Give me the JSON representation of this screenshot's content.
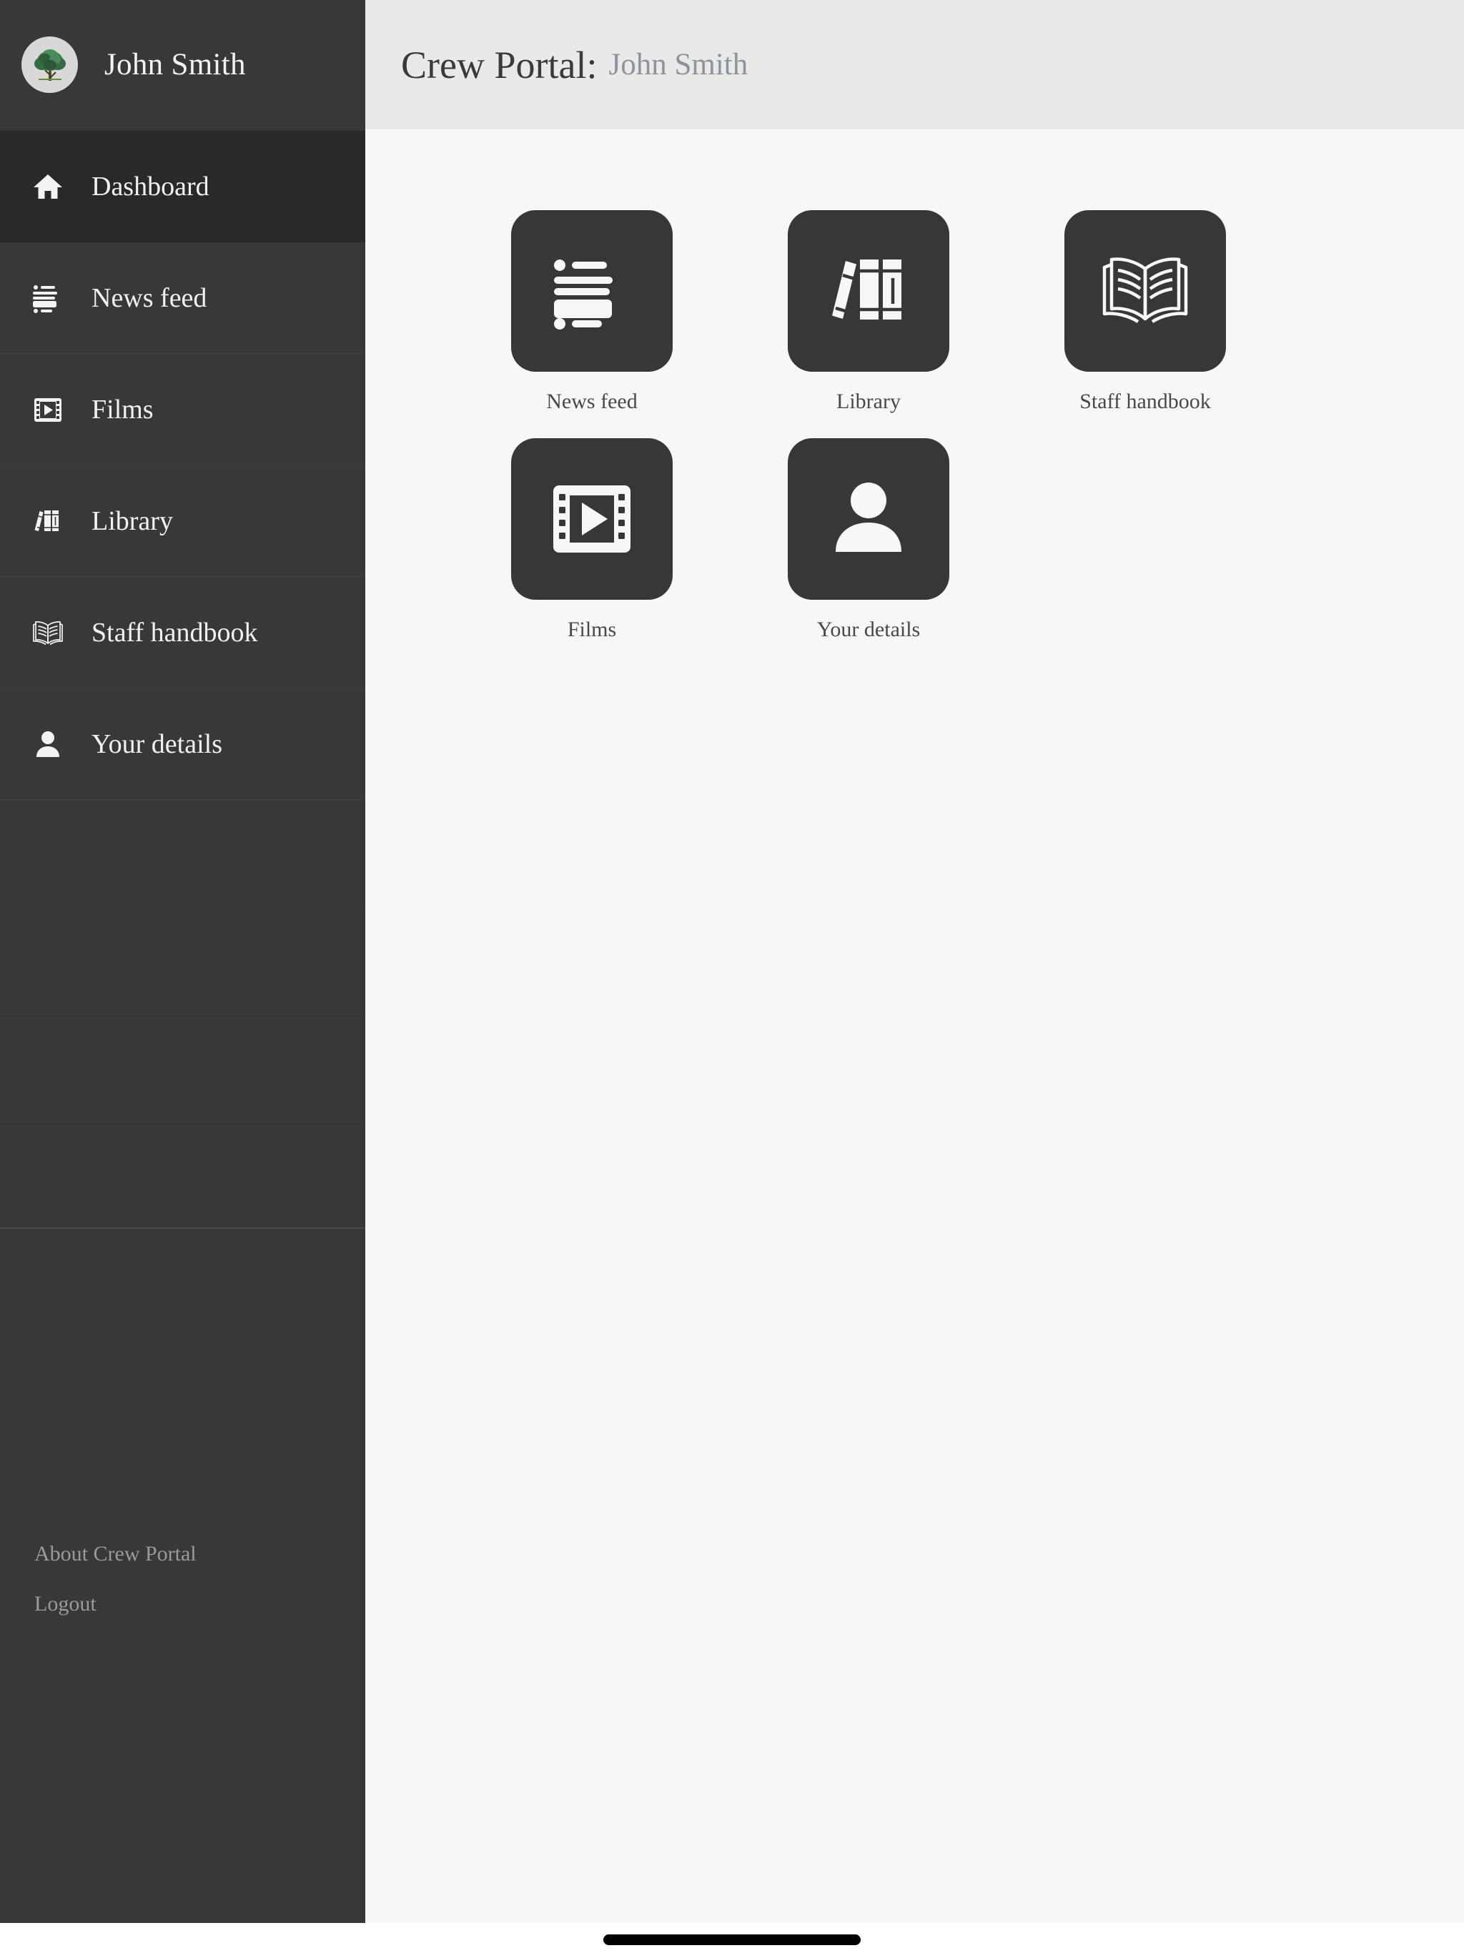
{
  "sidebar": {
    "profile": {
      "name": "John Smith",
      "avatar_icon": "tree-avatar-icon",
      "avatar_bg": "#d8d8d6"
    },
    "items": [
      {
        "label": "Dashboard",
        "icon": "home-icon",
        "active": true
      },
      {
        "label": "News feed",
        "icon": "feed-list-icon",
        "active": false
      },
      {
        "label": "Films",
        "icon": "film-strip-icon",
        "active": false
      },
      {
        "label": "Library",
        "icon": "books-icon",
        "active": false
      },
      {
        "label": "Staff handbook",
        "icon": "open-book-icon",
        "active": false
      },
      {
        "label": "Your details",
        "icon": "person-icon",
        "active": false
      }
    ],
    "footer_links": [
      {
        "label": "About Crew Portal"
      },
      {
        "label": "Logout"
      }
    ]
  },
  "header": {
    "title": "Crew Portal:",
    "subtitle": "John Smith"
  },
  "main": {
    "tiles": [
      {
        "label": "News feed",
        "icon": "feed-list-icon"
      },
      {
        "label": "Library",
        "icon": "books-icon"
      },
      {
        "label": "Staff handbook",
        "icon": "open-book-icon"
      },
      {
        "label": "Films",
        "icon": "film-strip-icon"
      },
      {
        "label": "Your details",
        "icon": "person-icon"
      }
    ]
  },
  "system": {
    "home_indicator": "home-indicator-bar"
  },
  "colors": {
    "sidebar_bg": "#393836",
    "sidebar_active_bg": "#2a2927",
    "topbar_bg": "#e9e9e8",
    "content_bg": "#f7f7f6",
    "tile_bg": "#383735",
    "title_text": "#3b3a38",
    "subtitle_text": "#8b949c",
    "footer_link_text": "#9c9a96"
  }
}
